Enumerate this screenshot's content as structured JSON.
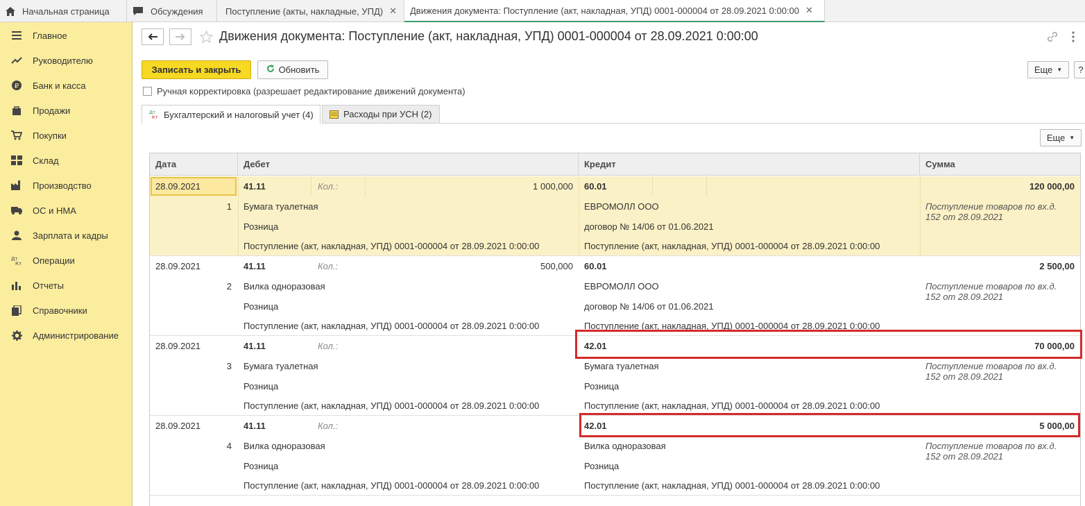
{
  "tabs": [
    {
      "label": "Начальная страница",
      "icon": "home-icon"
    },
    {
      "label": "Обсуждения",
      "icon": "chat-icon"
    },
    {
      "label": "Поступление (акты, накладные, УПД)",
      "icon": ""
    },
    {
      "label": "Движения документа: Поступление (акт, накладная, УПД) 0001-000004 от 28.09.2021 0:00:00",
      "icon": ""
    }
  ],
  "sidebar": {
    "items": [
      {
        "label": "Главное",
        "icon": "menu-icon"
      },
      {
        "label": "Руководителю",
        "icon": "trend-icon"
      },
      {
        "label": "Банк и касса",
        "icon": "ruble-icon"
      },
      {
        "label": "Продажи",
        "icon": "bag-icon"
      },
      {
        "label": "Покупки",
        "icon": "cart-icon"
      },
      {
        "label": "Склад",
        "icon": "warehouse-icon"
      },
      {
        "label": "Производство",
        "icon": "factory-icon"
      },
      {
        "label": "ОС и НМА",
        "icon": "truck-icon"
      },
      {
        "label": "Зарплата и кадры",
        "icon": "person-icon"
      },
      {
        "label": "Операции",
        "icon": "dtkt-icon"
      },
      {
        "label": "Отчеты",
        "icon": "barchart-icon"
      },
      {
        "label": "Справочники",
        "icon": "books-icon"
      },
      {
        "label": "Администрирование",
        "icon": "gear-icon"
      }
    ]
  },
  "header": {
    "title": "Движения документа: Поступление (акт, накладная, УПД) 0001-000004 от 28.09.2021 0:00:00"
  },
  "toolbar": {
    "save_close": "Записать и закрыть",
    "refresh": "Обновить",
    "more": "Еще",
    "help": "?"
  },
  "manual_edit": {
    "label": "Ручная корректировка (разрешает редактирование движений документа)",
    "checked": false
  },
  "form_tabs": [
    {
      "label": "Бухгалтерский и налоговый учет (4)",
      "icon": "dtkt-icon"
    },
    {
      "label": "Расходы при УСН (2)",
      "icon": "register-icon"
    }
  ],
  "grid": {
    "more": "Еще",
    "columns": [
      "Дата",
      "Дебет",
      "Кредит",
      "Сумма"
    ],
    "rows": [
      {
        "date": "28.09.2021",
        "n": "1",
        "debit_account": "41.11",
        "qty_label": "Кол.:",
        "debit_qty": "1 000,000",
        "debit_sub1": "Бумага туалетная",
        "debit_sub2": "Розница",
        "debit_sub3": "Поступление (акт, накладная, УПД) 0001-000004 от 28.09.2021 0:00:00",
        "credit_account": "60.01",
        "credit_sub1": "ЕВРОМОЛЛ ООО",
        "credit_sub2": "договор № 14/06 от 01.06.2021",
        "credit_sub3": "Поступление (акт, накладная, УПД) 0001-000004 от 28.09.2021 0:00:00",
        "amount": "120 000,00",
        "content": "Поступление товаров по вх.д. 152 от 28.09.2021"
      },
      {
        "date": "28.09.2021",
        "n": "2",
        "debit_account": "41.11",
        "qty_label": "Кол.:",
        "debit_qty": "500,000",
        "debit_sub1": "Вилка одноразовая",
        "debit_sub2": "Розница",
        "debit_sub3": "Поступление (акт, накладная, УПД) 0001-000004 от 28.09.2021 0:00:00",
        "credit_account": "60.01",
        "credit_sub1": "ЕВРОМОЛЛ ООО",
        "credit_sub2": "договор № 14/06 от 01.06.2021",
        "credit_sub3": "Поступление (акт, накладная, УПД) 0001-000004 от 28.09.2021 0:00:00",
        "amount": "2 500,00",
        "content": "Поступление товаров по вх.д. 152 от 28.09.2021"
      },
      {
        "date": "28.09.2021",
        "n": "3",
        "debit_account": "41.11",
        "qty_label": "Кол.:",
        "debit_qty": "",
        "debit_sub1": "Бумага туалетная",
        "debit_sub2": "Розница",
        "debit_sub3": "Поступление (акт, накладная, УПД) 0001-000004 от 28.09.2021 0:00:00",
        "credit_account": "42.01",
        "credit_sub1": "Бумага туалетная",
        "credit_sub2": "Розница",
        "credit_sub3": "Поступление (акт, накладная, УПД) 0001-000004 от 28.09.2021 0:00:00",
        "amount": "70 000,00",
        "content": "Поступление товаров по вх.д. 152 от 28.09.2021"
      },
      {
        "date": "28.09.2021",
        "n": "4",
        "debit_account": "41.11",
        "qty_label": "Кол.:",
        "debit_qty": "",
        "debit_sub1": "Вилка одноразовая",
        "debit_sub2": "Розница",
        "debit_sub3": "Поступление (акт, накладная, УПД) 0001-000004 от 28.09.2021 0:00:00",
        "credit_account": "42.01",
        "credit_sub1": "Вилка одноразовая",
        "credit_sub2": "Розница",
        "credit_sub3": "Поступление (акт, накладная, УПД) 0001-000004 от 28.09.2021 0:00:00",
        "amount": "5 000,00",
        "content": "Поступление товаров по вх.д. 152 от 28.09.2021"
      }
    ]
  },
  "colors": {
    "sidebar_bg": "#fbed9e",
    "save_button": "#f7d823",
    "selected_row": "#fbf1c6",
    "highlight_frame": "#d42a2a",
    "active_tab_underline": "#3c9a6a"
  }
}
